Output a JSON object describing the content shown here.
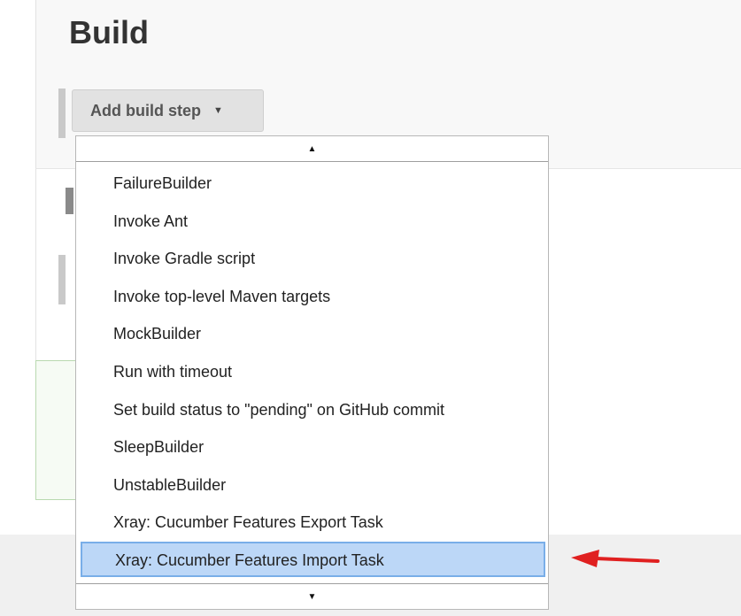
{
  "section": {
    "title": "Build"
  },
  "add_step": {
    "label": "Add build step"
  },
  "dropdown": {
    "scroll_up_glyph": "▲",
    "scroll_down_glyph": "▼",
    "items": [
      {
        "label": "FailureBuilder"
      },
      {
        "label": "Invoke Ant"
      },
      {
        "label": "Invoke Gradle script"
      },
      {
        "label": "Invoke top-level Maven targets"
      },
      {
        "label": "MockBuilder"
      },
      {
        "label": "Run with timeout"
      },
      {
        "label": "Set build status to \"pending\" on GitHub commit"
      },
      {
        "label": "SleepBuilder"
      },
      {
        "label": "UnstableBuilder"
      },
      {
        "label": "Xray: Cucumber Features Export Task"
      },
      {
        "label": "Xray: Cucumber Features Import Task"
      }
    ],
    "selected_label": "Xray: Cucumber Features Import Task"
  },
  "colors": {
    "selection_fill": "#bcd7f7",
    "selection_border": "#79aee8",
    "annotation_arrow": "#e02020"
  },
  "icons": {
    "caret": "chevron-down-icon",
    "annotation": "red-arrow-icon"
  }
}
